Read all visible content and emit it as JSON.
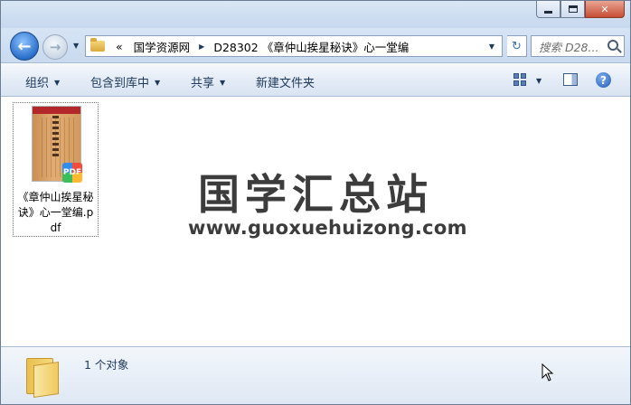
{
  "window": {
    "caption": {
      "minimize": "minimize",
      "maximize": "maximize",
      "close": "✕"
    }
  },
  "nav": {
    "breadcrumb_prefix": "«",
    "crumbs": [
      "国学资源网",
      "D28302 《章仲山挨星秘诀》心一堂编"
    ],
    "search_placeholder": "搜索 D28...",
    "refresh_glyph": "↻"
  },
  "toolbar": {
    "organize": "组织",
    "include_in_library": "包含到库中",
    "share": "共享",
    "new_folder": "新建文件夹",
    "help": "?"
  },
  "content": {
    "file": {
      "name": "《章仲山挨星秘诀》心一堂编.pdf",
      "badge": "PDF"
    },
    "watermark": {
      "title": "国学汇总站",
      "url": "www.guoxuehuizong.com"
    }
  },
  "details": {
    "status": "1 个对象"
  },
  "colors": {
    "frame": "#c5d6ec",
    "text": "#1e395b",
    "close_button": "#c74e34",
    "back_button": "#2a6fc9"
  },
  "icons": [
    "back-arrow-icon",
    "forward-arrow-icon",
    "folder-icon",
    "refresh-icon",
    "search-icon",
    "view-options-icon",
    "preview-pane-icon",
    "help-icon",
    "pdf-file-icon",
    "mouse-cursor-icon"
  ]
}
